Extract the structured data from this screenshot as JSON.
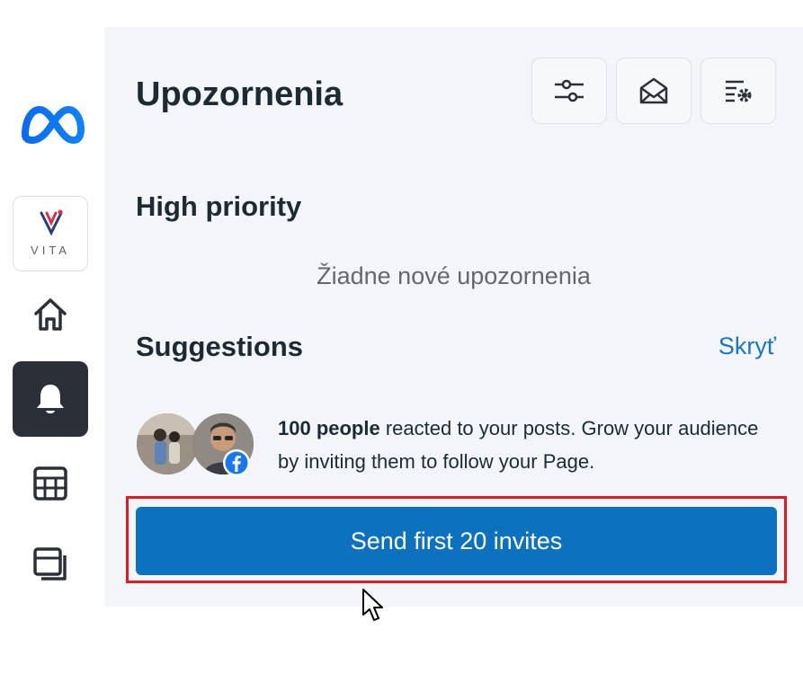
{
  "header": {
    "title": "Upozornenia"
  },
  "toolbar": {
    "buttons": [
      {
        "name": "filter-settings",
        "icon": "sliders-icon"
      },
      {
        "name": "mark-all-read",
        "icon": "open-envelope-icon"
      },
      {
        "name": "notification-settings",
        "icon": "list-gear-icon"
      }
    ]
  },
  "sidebar": {
    "page_avatar_label": "VITA",
    "items": [
      {
        "icon": "home-icon",
        "active": false
      },
      {
        "icon": "bell-icon",
        "active": true
      },
      {
        "icon": "table-icon",
        "active": false
      },
      {
        "icon": "pages-icon",
        "active": false
      }
    ]
  },
  "high_priority": {
    "heading": "High priority",
    "empty_message": "Žiadne nové upozornenia"
  },
  "suggestions": {
    "heading": "Suggestions",
    "hide_label": "Skryť",
    "item": {
      "bold_text": "100 people",
      "text": " reacted to your posts. Grow your audience by inviting them to follow your Page."
    },
    "cta_label": "Send first 20 invites"
  },
  "colors": {
    "accent": "#0c72c0",
    "link": "#1877c5",
    "highlight": "#e01b22",
    "active_nav": "#2b3038",
    "panel_bg": "#f3f5f8"
  }
}
